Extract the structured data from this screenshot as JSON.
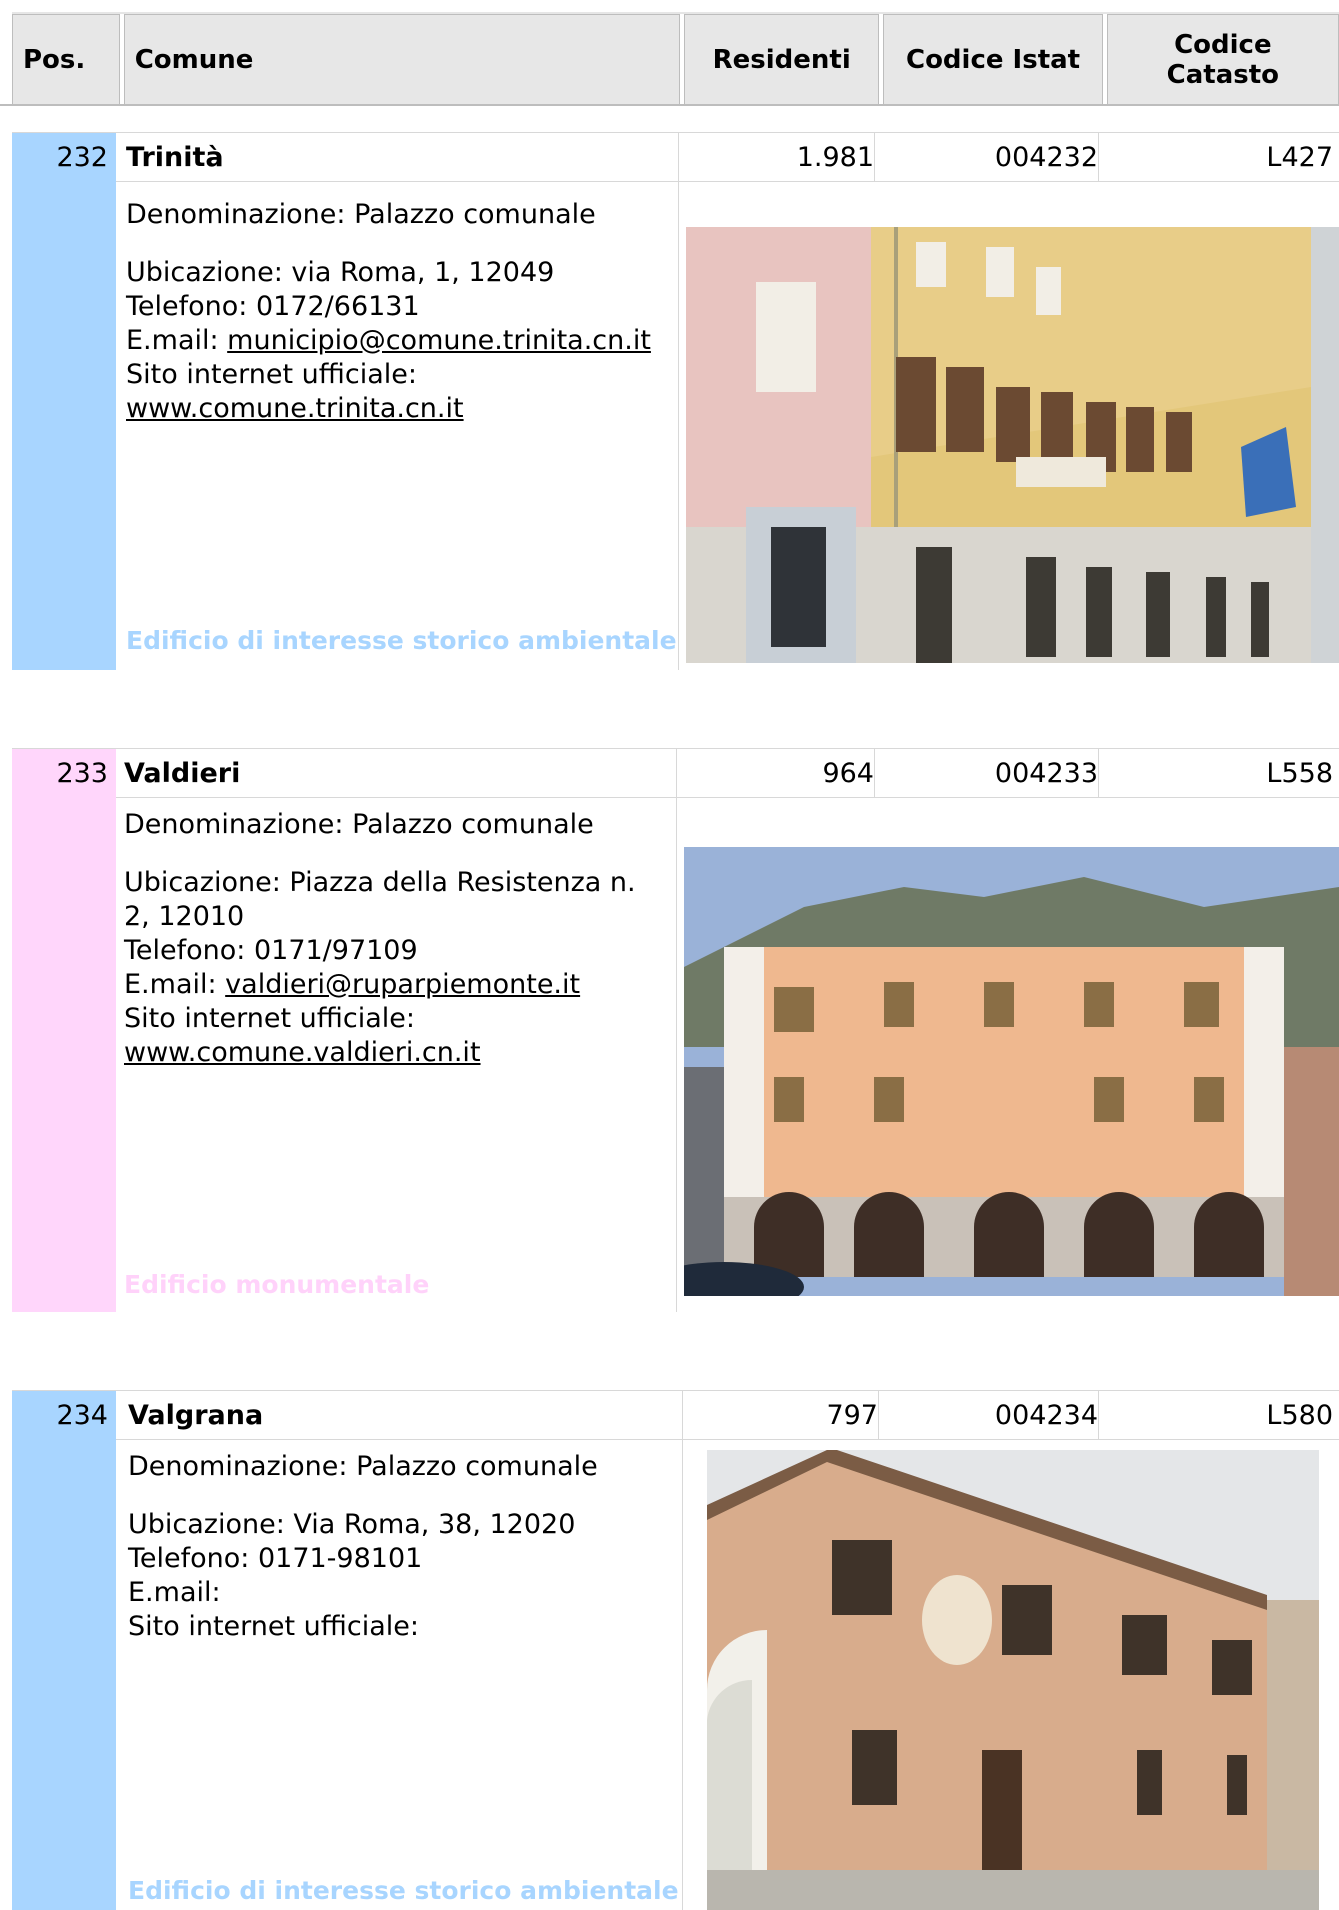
{
  "header": {
    "pos": "Pos.",
    "comune": "Comune",
    "residenti": "Residenti",
    "istat": "Codice Istat",
    "catasto_line1": "Codice",
    "catasto_line2": "Catasto"
  },
  "colors": {
    "blue": "#a8d5ff",
    "pink": "#ffd6fb",
    "blue_text": "#a8d5ff",
    "pink_text": "#ffd2fa"
  },
  "entries": [
    {
      "pos": "232",
      "name": "Trinità",
      "residenti": "1.981",
      "istat": "004232",
      "catasto": "L427",
      "denominazione": "Denominazione: Palazzo comunale",
      "ubicazione": "Ubicazione: via Roma, 1, 12049",
      "telefono": "Telefono: 0172/66131",
      "email_label": "E.mail: ",
      "email": "municipio@comune.trinita.cn.it",
      "sito_label": "Sito internet ufficiale:",
      "sito": "www.comune.trinita.cn.it",
      "categoria": "Edificio di interesse storico ambientale",
      "photo": "palazzo-comunale-trinita-photo"
    },
    {
      "pos": "233",
      "name": "Valdieri",
      "residenti": "964",
      "istat": "004233",
      "catasto": "L558",
      "denominazione": "Denominazione: Palazzo comunale",
      "ubicazione1": "Ubicazione: Piazza della Resistenza n.",
      "ubicazione2": "2, 12010",
      "telefono": "Telefono: 0171/97109",
      "email_label": "E.mail: ",
      "email": "valdieri@ruparpiemonte.it",
      "sito_label": "Sito internet ufficiale:",
      "sito": "www.comune.valdieri.cn.it",
      "categoria": "Edificio  monumentale",
      "photo": "palazzo-comunale-valdieri-photo"
    },
    {
      "pos": "234",
      "name": "Valgrana",
      "residenti": "797",
      "istat": "004234",
      "catasto": "L580",
      "denominazione": "Denominazione: Palazzo comunale",
      "ubicazione": "Ubicazione: Via Roma, 38, 12020",
      "telefono": "Telefono: 0171-98101",
      "email_label": "E.mail:",
      "sito_label": "Sito internet ufficiale:",
      "categoria": "Edificio di interesse storico ambientale",
      "photo": "palazzo-comunale-valgrana-photo"
    }
  ]
}
